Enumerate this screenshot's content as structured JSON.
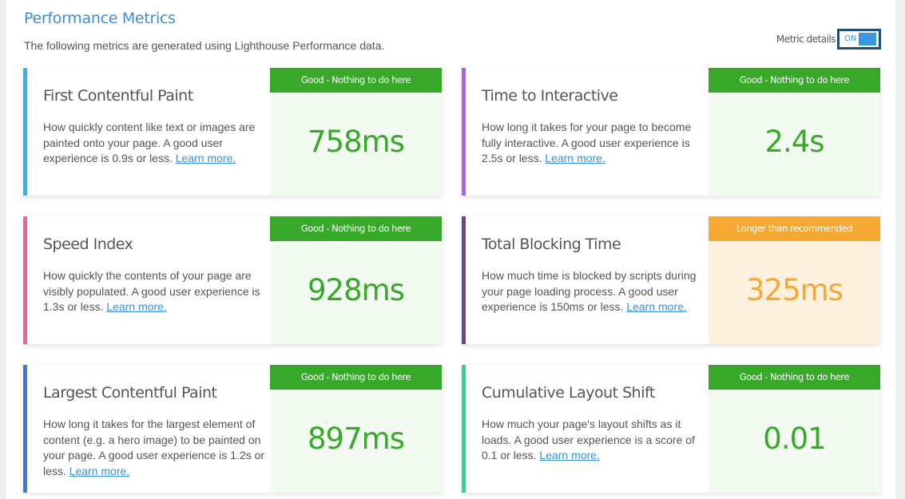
{
  "header": {
    "title": "Performance Metrics",
    "subtitle": "The following metrics are generated using Lighthouse Performance data.",
    "toggle_label": "Metric details",
    "toggle_state": "ON"
  },
  "colors": {
    "good": "#37a829",
    "warning": "#f5a834",
    "title_blue": "#3a8fd6"
  },
  "metrics": [
    {
      "title": "First Contentful Paint",
      "description": "How quickly content like text or images are painted onto your page. A good user experience is 0.9s or less.",
      "link": "Learn more.",
      "status": "Good - Nothing to do here",
      "value": "758ms",
      "accent": "#2bb6f0"
    },
    {
      "title": "Time to Interactive",
      "description": "How long it takes for your page to become fully interactive. A good user experience is 2.5s or less.",
      "link": "Learn more.",
      "status": "Good - Nothing to do here",
      "value": "2.4s",
      "accent": "#a66cc9"
    },
    {
      "title": "Speed Index",
      "description": "How quickly the contents of your page are visibly populated. A good user experience is 1.3s or less.",
      "link": "Learn more.",
      "status": "Good - Nothing to do here",
      "value": "928ms",
      "accent": "#f0609e"
    },
    {
      "title": "Total Blocking Time",
      "description": "How much time is blocked by scripts during your page loading process. A good user experience is 150ms or less.",
      "link": "Learn more.",
      "status": "Longer than recommended",
      "value": "325ms",
      "accent": "#6b4a7e"
    },
    {
      "title": "Largest Contentful Paint",
      "description": "How long it takes for the largest element of content (e.g. a hero image) to be painted on your page. A good user experience is 1.2s or less.",
      "link": "Learn more.",
      "status": "Good - Nothing to do here",
      "value": "897ms",
      "accent": "#3a78e0"
    },
    {
      "title": "Cumulative Layout Shift",
      "description": "How much your page's layout shifts as it loads. A good user experience is a score of 0.1 or less.",
      "link": "Learn more.",
      "status": "Good - Nothing to do here",
      "value": "0.01",
      "accent": "#4cc49a"
    }
  ]
}
